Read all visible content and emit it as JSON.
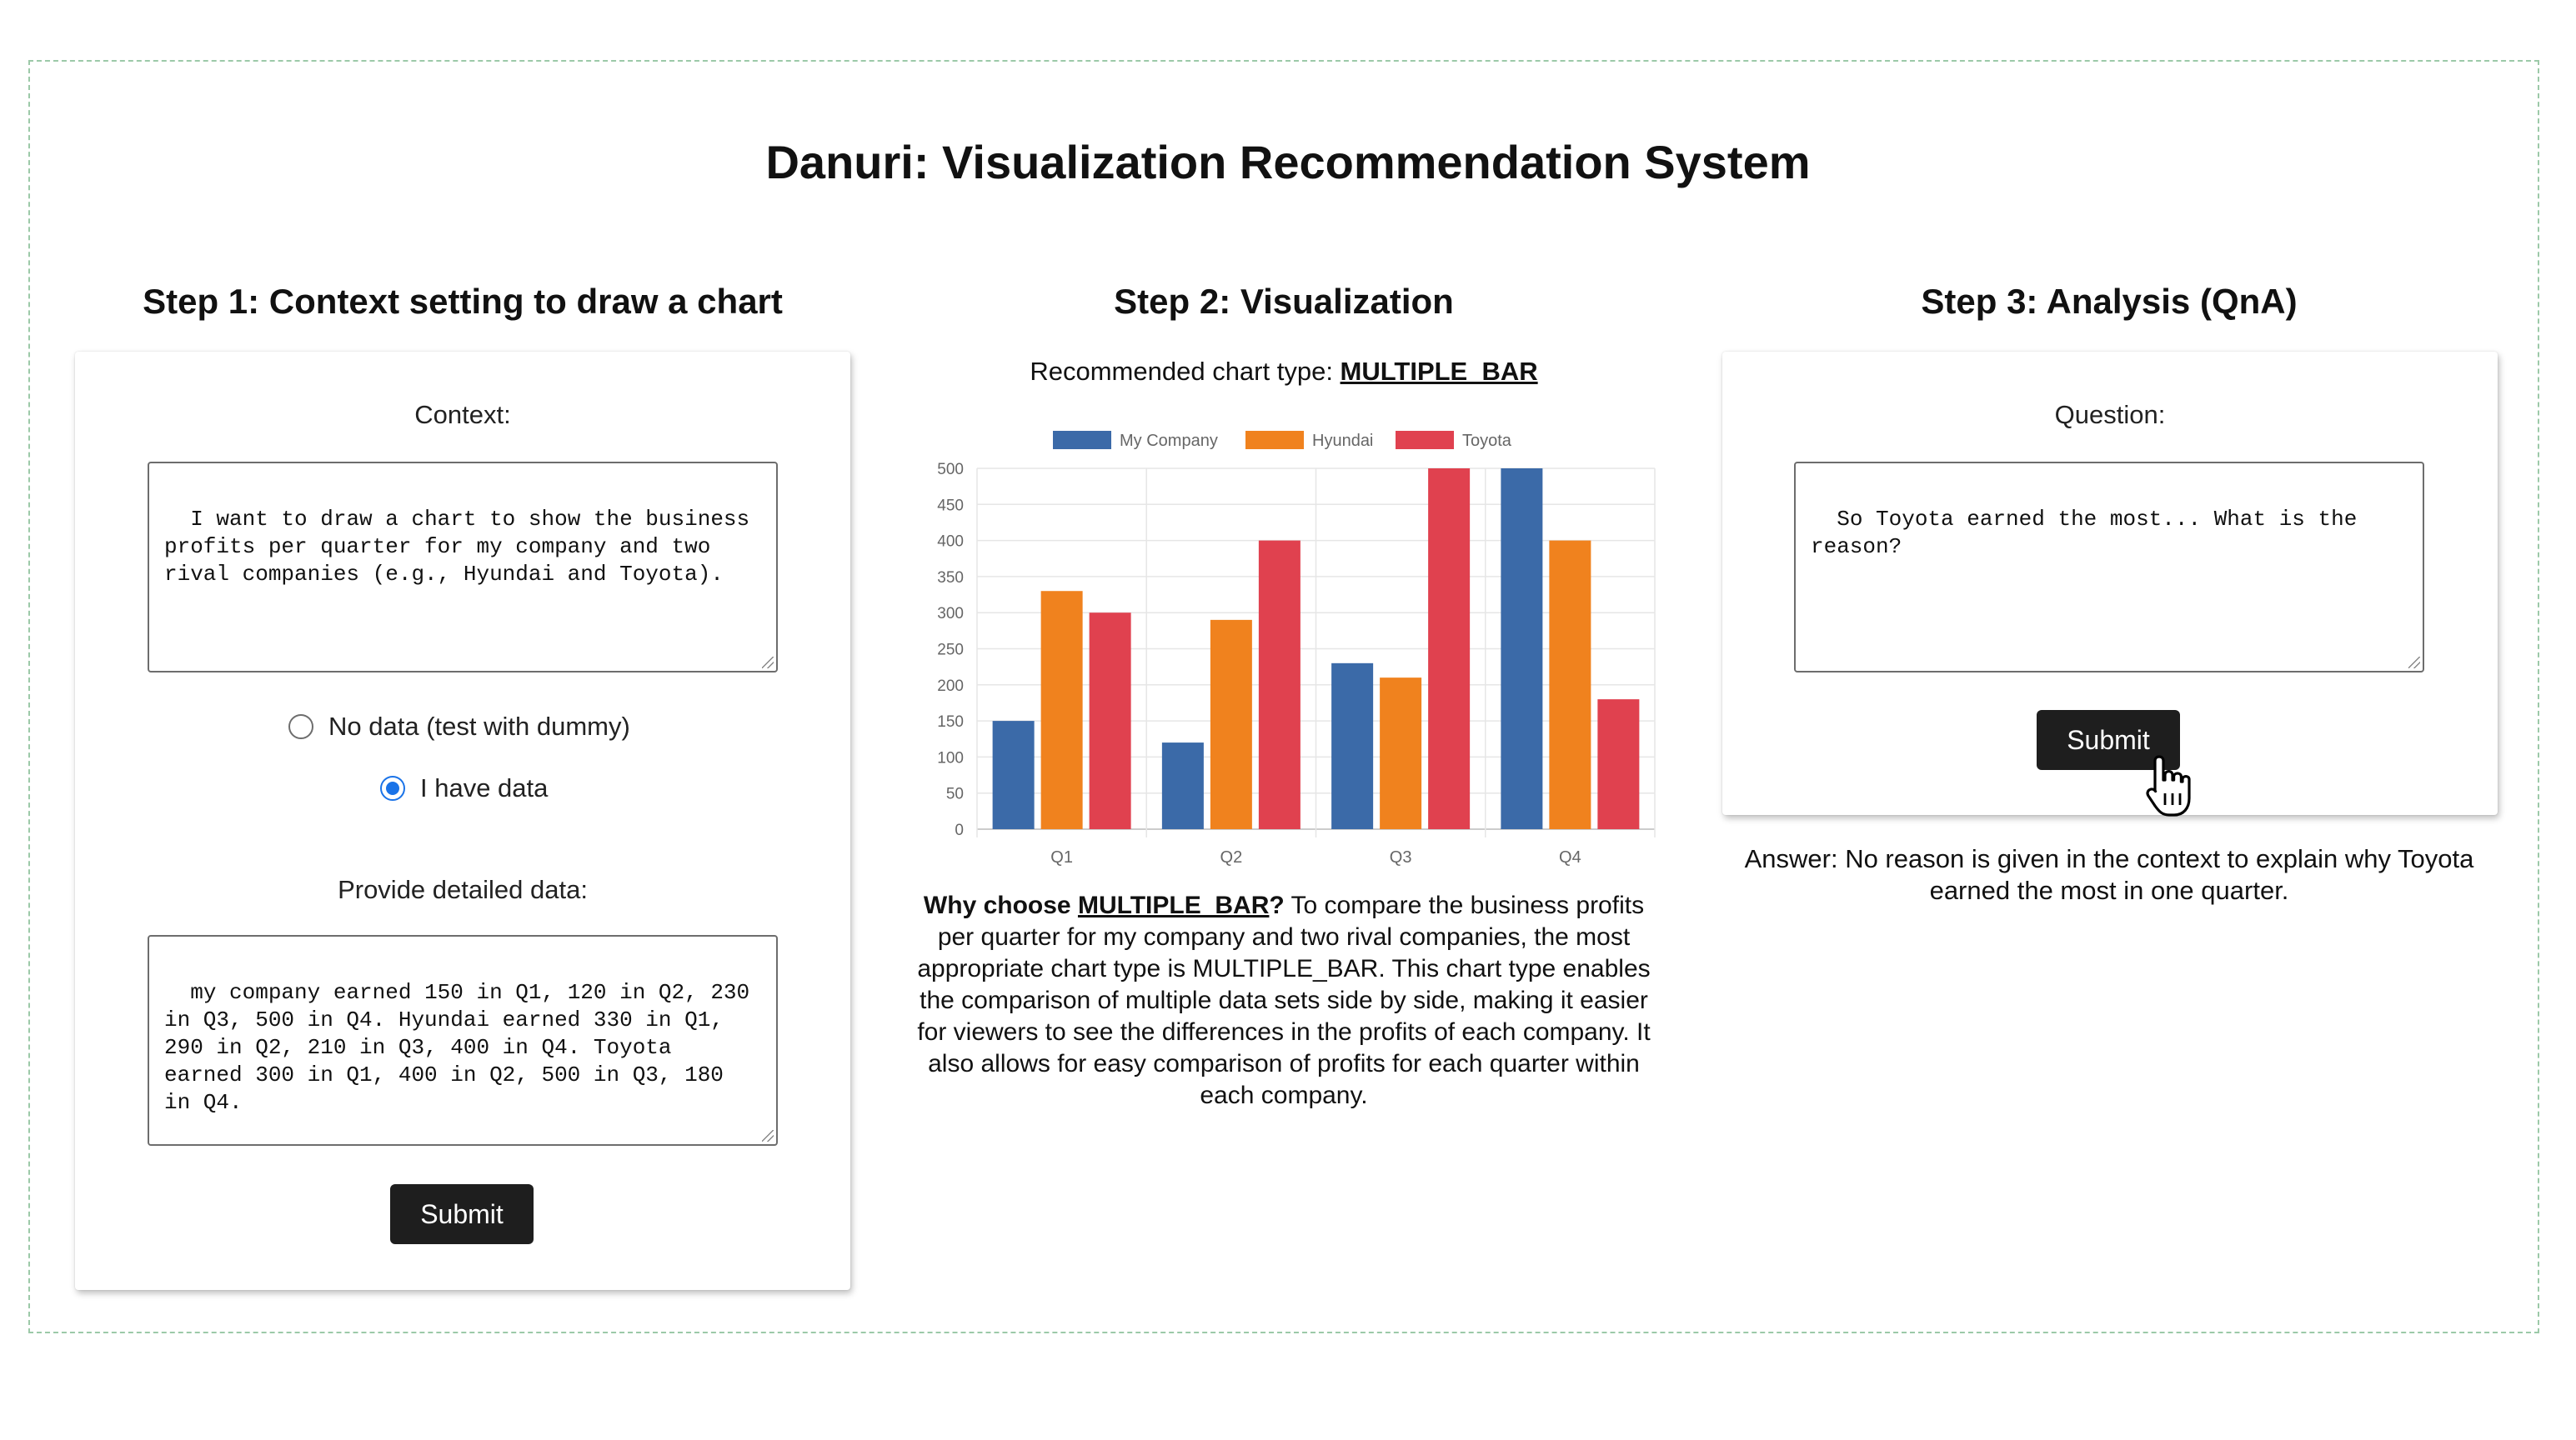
{
  "title": "Danuri: Visualization Recommendation System",
  "step1": {
    "title": "Step 1: Context setting to draw a chart",
    "context_label": "Context:",
    "context_value": "I want to draw a chart to show the business profits per quarter for my company and two rival companies (e.g., Hyundai and Toyota).",
    "radio_no_data": "No data (test with dummy)",
    "radio_have_data": "I have data",
    "data_label": "Provide detailed data:",
    "data_value": "my company earned 150 in Q1, 120 in Q2, 230 in Q3, 500 in Q4. Hyundai earned 330 in Q1, 290 in Q2, 210 in Q3, 400 in Q4. Toyota earned 300 in Q1, 400 in Q2, 500 in Q3, 180 in Q4.",
    "submit_label": "Submit"
  },
  "step2": {
    "title": "Step 2: Visualization",
    "recommended_prefix": "Recommended chart type: ",
    "recommended_type": "MULTIPLE_BAR",
    "why_prefix": "Why choose ",
    "why_type": "MULTIPLE_BAR",
    "why_q": "?",
    "why_body": " To compare the business profits per quarter for my company and two rival companies, the most appropriate chart type is MULTIPLE_BAR. This chart type enables the comparison of multiple data sets side by side, making it easier for viewers to see the differences in the profits of each company. It also allows for easy comparison of profits for each quarter within each company."
  },
  "step3": {
    "title": "Step 3: Analysis (QnA)",
    "question_label": "Question:",
    "question_value": "So Toyota earned the most... What is the reason?",
    "submit_label": "Submit",
    "answer": "Answer: No reason is given in the context to explain why Toyota earned the most in one quarter."
  },
  "cursor_icon": "hand-pointer-icon",
  "chart_data": {
    "type": "bar",
    "categories": [
      "Q1",
      "Q2",
      "Q3",
      "Q4"
    ],
    "series": [
      {
        "name": "My Company",
        "values": [
          150,
          120,
          230,
          500
        ],
        "color": "#3b6aa8"
      },
      {
        "name": "Hyundai",
        "values": [
          330,
          290,
          210,
          400
        ],
        "color": "#f0821e"
      },
      {
        "name": "Toyota",
        "values": [
          300,
          400,
          500,
          180
        ],
        "color": "#e0414f"
      }
    ],
    "ylim": [
      0,
      500
    ],
    "yticks": [
      "0",
      "50",
      "100",
      "150",
      "200",
      "250",
      "300",
      "350",
      "400",
      "450",
      "500"
    ],
    "grid": true,
    "legend": "top-center"
  }
}
